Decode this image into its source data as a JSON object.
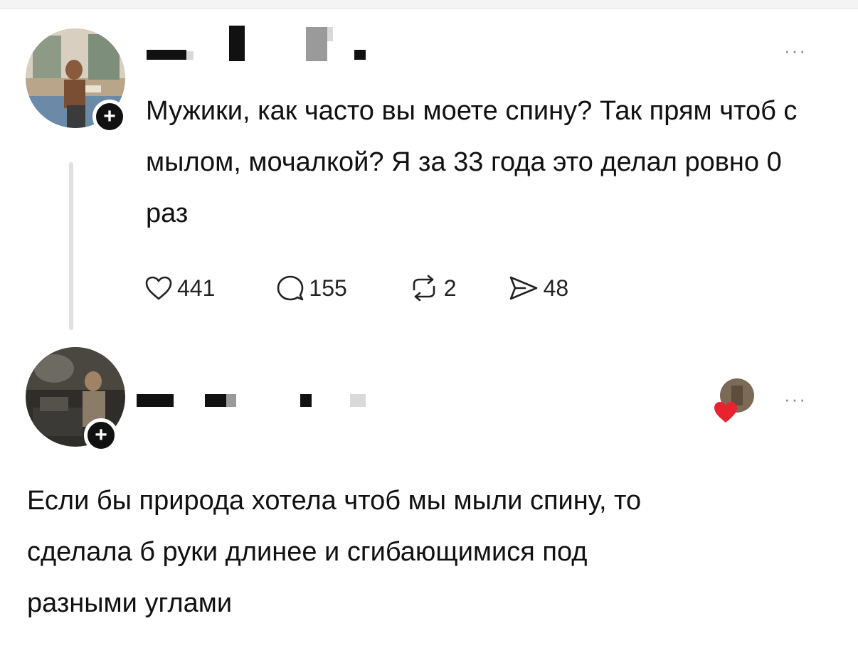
{
  "posts": [
    {
      "text": "Мужики, как часто вы моете спину? Так прям чтоб с мылом, мочалкой? Я за 33 года это делал ровно 0 раз",
      "more": "···",
      "follow_badge": "+",
      "stats": {
        "likes": "441",
        "replies": "155",
        "reposts": "2",
        "shares": "48"
      }
    },
    {
      "text": "Если бы природа хотела чтоб мы мыли спину, то сделала б руки длинее и сгибающимися под разными углами",
      "more": "···",
      "follow_badge": "+"
    }
  ],
  "icons": {
    "like": "heart-icon",
    "reply": "comment-icon",
    "repost": "repost-icon",
    "share": "send-icon",
    "author_liked": "heart-filled-icon"
  },
  "colors": {
    "text": "#111111",
    "muted": "#8a8a8a",
    "heart": "#e8232f",
    "thread": "#e1e1e1"
  }
}
